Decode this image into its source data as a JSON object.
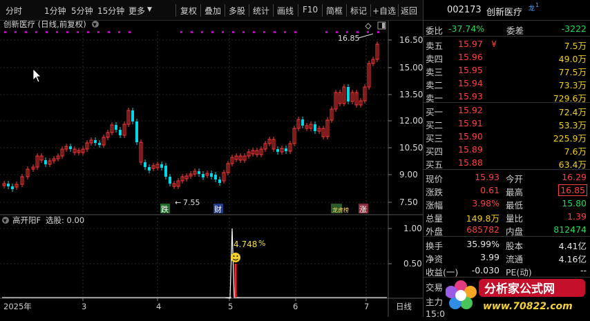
{
  "toolbar": {
    "items": [
      "分时",
      "1分钟",
      "5分钟",
      "15分钟",
      "更多",
      "复权",
      "叠加",
      "多股",
      "统计",
      "画线",
      "F10",
      "简框",
      "标记",
      "+自选",
      "返回"
    ]
  },
  "main_chart": {
    "title": "创新医疗 (日线,前复权)",
    "y_ticks": [
      "16.50",
      "15.00",
      "13.50",
      "12.00",
      "10.50",
      "9.00",
      "7.50"
    ],
    "high_label": "16.85",
    "low_label": "7.55",
    "markers": [
      "跌",
      "财",
      "龙虎榜",
      "涨"
    ]
  },
  "indicator": {
    "title": "高开阳F",
    "selection": "选股: 0.00",
    "y_ticks": [
      "1.00",
      "0.50"
    ],
    "value_label": "4.748",
    "unit": "%"
  },
  "x_axis": {
    "labels": [
      "2025年",
      "3",
      "4",
      "5",
      "6",
      "7"
    ],
    "period": "日线"
  },
  "quote": {
    "code": "002173",
    "name": "创新医疗",
    "tag": "龙",
    "weibi_label": "委比",
    "weibi": "-37.74%",
    "weicha_label": "委差",
    "weicha": "-3222",
    "asks": [
      {
        "l": "卖五",
        "p": "15.97",
        "v": "7.5万",
        "mark": "¥"
      },
      {
        "l": "卖四",
        "p": "15.96",
        "v": "49.0万"
      },
      {
        "l": "卖三",
        "p": "15.95",
        "v": "77.5万"
      },
      {
        "l": "卖二",
        "p": "15.94",
        "v": "73.3万"
      },
      {
        "l": "卖一",
        "p": "15.93",
        "v": "729.6万"
      }
    ],
    "bids": [
      {
        "l": "买一",
        "p": "15.92",
        "v": "72.4万"
      },
      {
        "l": "买二",
        "p": "15.91",
        "v": "53.3万"
      },
      {
        "l": "买三",
        "p": "15.90",
        "v": "225.9万"
      },
      {
        "l": "买四",
        "p": "15.89",
        "v": "7.6万"
      },
      {
        "l": "买五",
        "p": "15.88",
        "v": "63.4万"
      }
    ],
    "stats1": [
      {
        "l1": "现价",
        "v1": "15.93",
        "l2": "今开",
        "v2": "16.29"
      },
      {
        "l1": "涨跌",
        "v1": "0.61",
        "l2": "最高",
        "v2": "16.85"
      },
      {
        "l1": "涨幅",
        "v1": "3.98%",
        "l2": "最低",
        "v2": "15.80"
      },
      {
        "l1": "总量",
        "v1": "149.8万",
        "l2": "量比",
        "v2": "1.39"
      },
      {
        "l1": "外盘",
        "v1": "685782",
        "l2": "内盘",
        "v2": "812474"
      }
    ],
    "stats2": [
      {
        "l1": "换手",
        "v1": "35.99%",
        "l2": "股本",
        "v2": "4.41亿"
      },
      {
        "l1": "净资",
        "v1": "3.99",
        "l2": "流通",
        "v2": "4.16亿"
      },
      {
        "l1": "收益(一)",
        "v1": "-0.030",
        "l2": "PE(动)",
        "v2": "--"
      }
    ],
    "extra": [
      "交易",
      "主力",
      "15:0"
    ]
  },
  "logo": {
    "title": "分析家公式网",
    "url": "www.70822.com"
  },
  "colors": {
    "up": "#ff3838",
    "down": "#00d8e8",
    "bg": "#000000",
    "accent": "#ff4040",
    "green": "#22dd55"
  }
}
